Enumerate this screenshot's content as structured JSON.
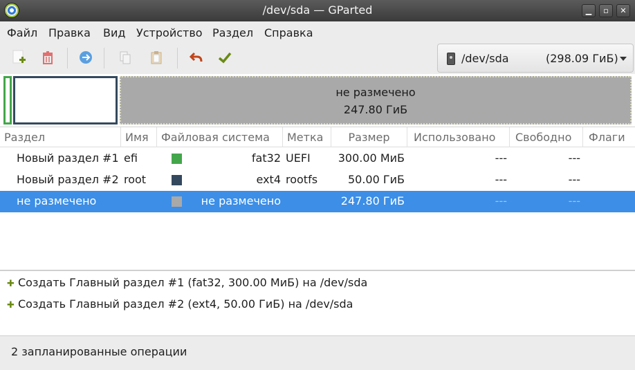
{
  "window": {
    "title": "/dev/sda — GParted"
  },
  "menu": {
    "items": [
      "Файл",
      "Правка",
      "Вид",
      "Устройство",
      "Раздел",
      "Справка"
    ]
  },
  "toolbar": {
    "buttons": [
      "new-partition",
      "delete-partition",
      "resize-move",
      "copy",
      "paste",
      "undo",
      "apply"
    ],
    "device": {
      "name": "/dev/sda",
      "size": "(298.09 ГиБ)"
    }
  },
  "diskmap": {
    "unallocated_label": "не размечено",
    "unallocated_size": "247.80 ГиБ",
    "colors": {
      "efi": "#44a64b",
      "root": "#34495e",
      "unallocated": "#a9a9a9"
    }
  },
  "table": {
    "columns": [
      "Раздел",
      "Имя",
      "Файловая система",
      "Метка",
      "Размер",
      "Использовано",
      "Свободно",
      "Флаги"
    ],
    "rows": [
      {
        "partition": "Новый раздел #1",
        "name": "efi",
        "fs": "fat32",
        "label": "UEFI",
        "size": "300.00 МиБ",
        "used": "---",
        "free": "---",
        "flags": "",
        "color": "#44a64b"
      },
      {
        "partition": "Новый раздел #2",
        "name": "root",
        "fs": "ext4",
        "label": "rootfs",
        "size": "50.00 ГиБ",
        "used": "---",
        "free": "---",
        "flags": "",
        "color": "#34495e"
      },
      {
        "partition": "не размечено",
        "name": "",
        "fs": "не размечено",
        "label": "",
        "size": "247.80 ГиБ",
        "used": "---",
        "free": "---",
        "flags": "",
        "color": "#a9a9a9"
      }
    ]
  },
  "operations": [
    "Создать Главный раздел #1 (fat32, 300.00 МиБ) на /dev/sda",
    "Создать Главный раздел #2 (ext4, 50.00 ГиБ) на /dev/sda"
  ],
  "status": {
    "text": "2 запланированные операции"
  }
}
